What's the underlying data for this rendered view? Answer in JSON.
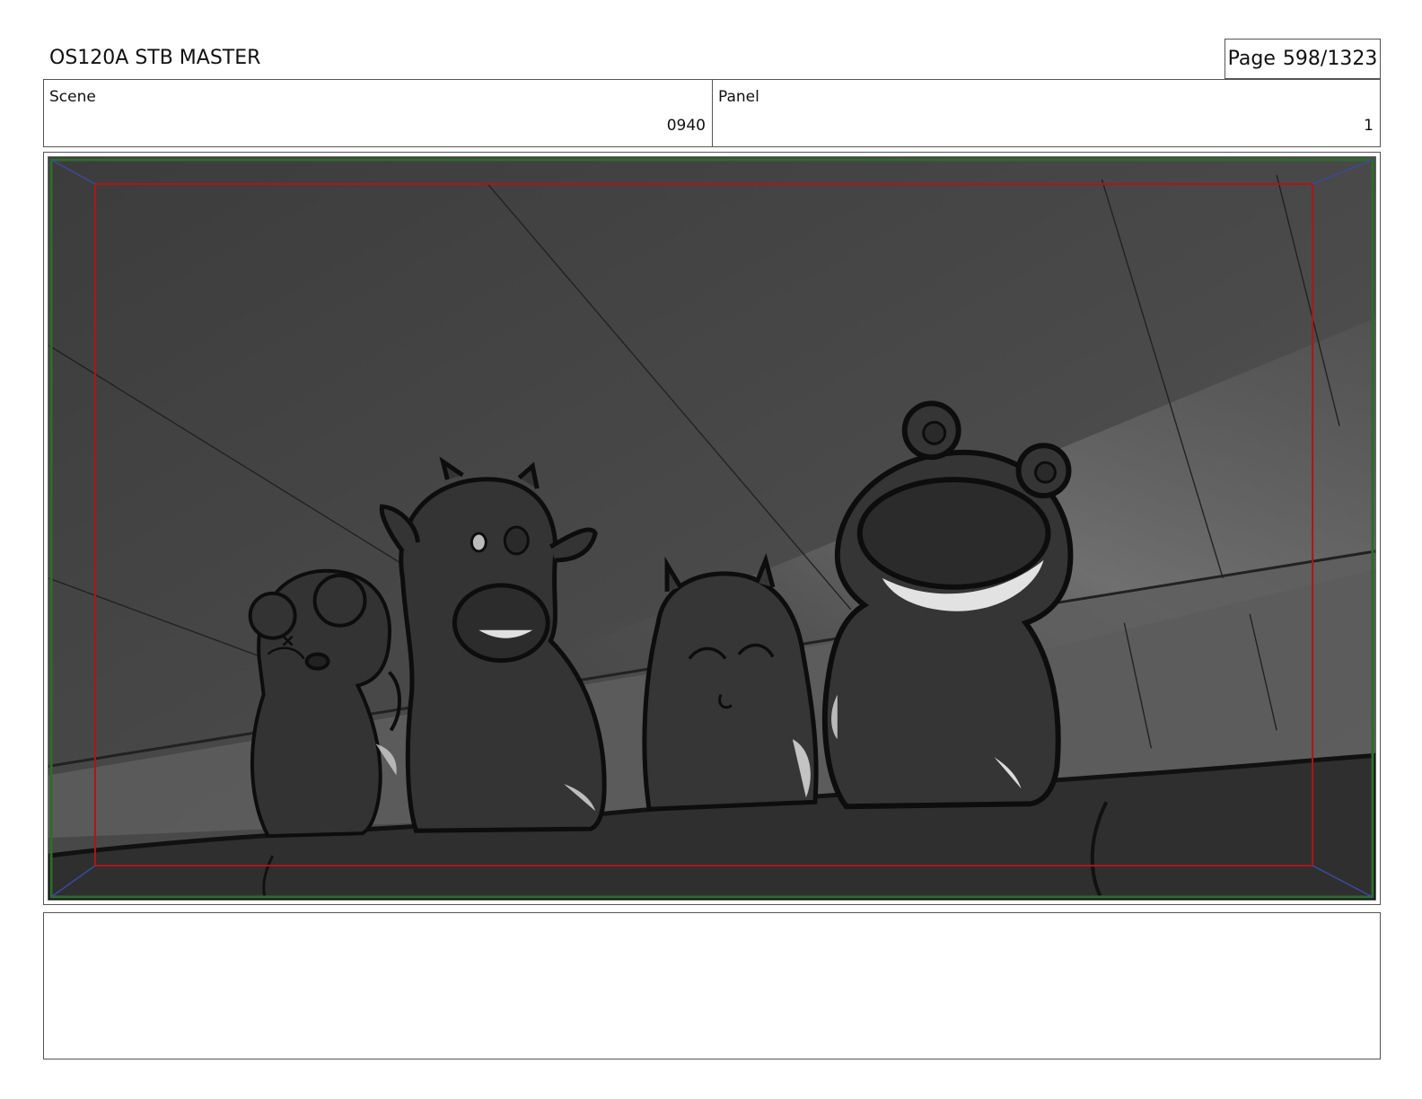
{
  "header": {
    "title": "OS120A STB MASTER",
    "page_label": "Page",
    "page_value": "598/1323"
  },
  "scene": {
    "label": "Scene",
    "value": "0940"
  },
  "panel": {
    "label": "Panel",
    "value": "1"
  },
  "notes": {
    "text": ""
  }
}
